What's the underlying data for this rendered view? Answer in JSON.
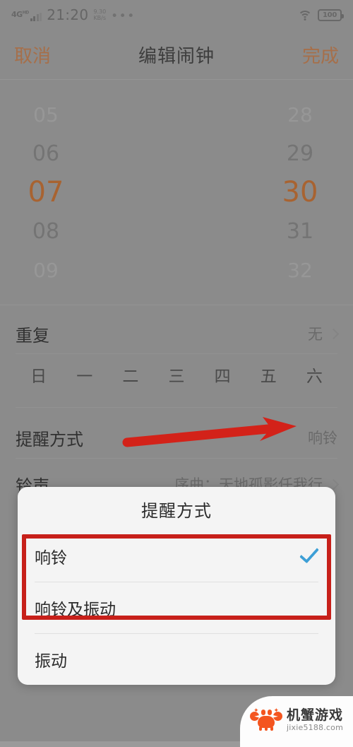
{
  "status_bar": {
    "network": "4G",
    "network_sup": "HD",
    "time": "21:20",
    "data_rate_value": "9.30",
    "data_rate_unit": "KB/s",
    "overflow": "•••",
    "battery": "100",
    "wifi_icon": "wifi-icon",
    "signal_icon": "signal-bars-icon"
  },
  "nav_bar": {
    "cancel": "取消",
    "title": "编辑闹钟",
    "done": "完成"
  },
  "time_picker": {
    "hours": [
      "05",
      "06",
      "07",
      "08",
      "09"
    ],
    "minutes": [
      "28",
      "29",
      "30",
      "31",
      "32"
    ],
    "selected_hour": "07",
    "selected_minute": "30",
    "accent_color": "#b5672e"
  },
  "rows": {
    "repeat": {
      "label": "重复",
      "value": "无"
    },
    "reminder": {
      "label": "提醒方式",
      "value": "响铃"
    },
    "ringtone": {
      "label": "铃声",
      "value": "序曲：天地孤影任我行"
    }
  },
  "weekdays": [
    "日",
    "一",
    "二",
    "三",
    "四",
    "五",
    "六"
  ],
  "dialog": {
    "title": "提醒方式",
    "options": [
      {
        "label": "响铃",
        "checked": true
      },
      {
        "label": "响铃及振动",
        "checked": false
      },
      {
        "label": "振动",
        "checked": false
      }
    ],
    "check_color": "#3d9fd6"
  },
  "annotations": {
    "arrow_color": "#d32219",
    "box_color": "#c7201a",
    "arrow_icon": "red-arrow-icon",
    "box_icon": "red-highlight-box"
  },
  "watermark": {
    "name": "机蟹游戏",
    "url": "jixie5188.com",
    "logo_icon": "crab-logo-icon"
  }
}
